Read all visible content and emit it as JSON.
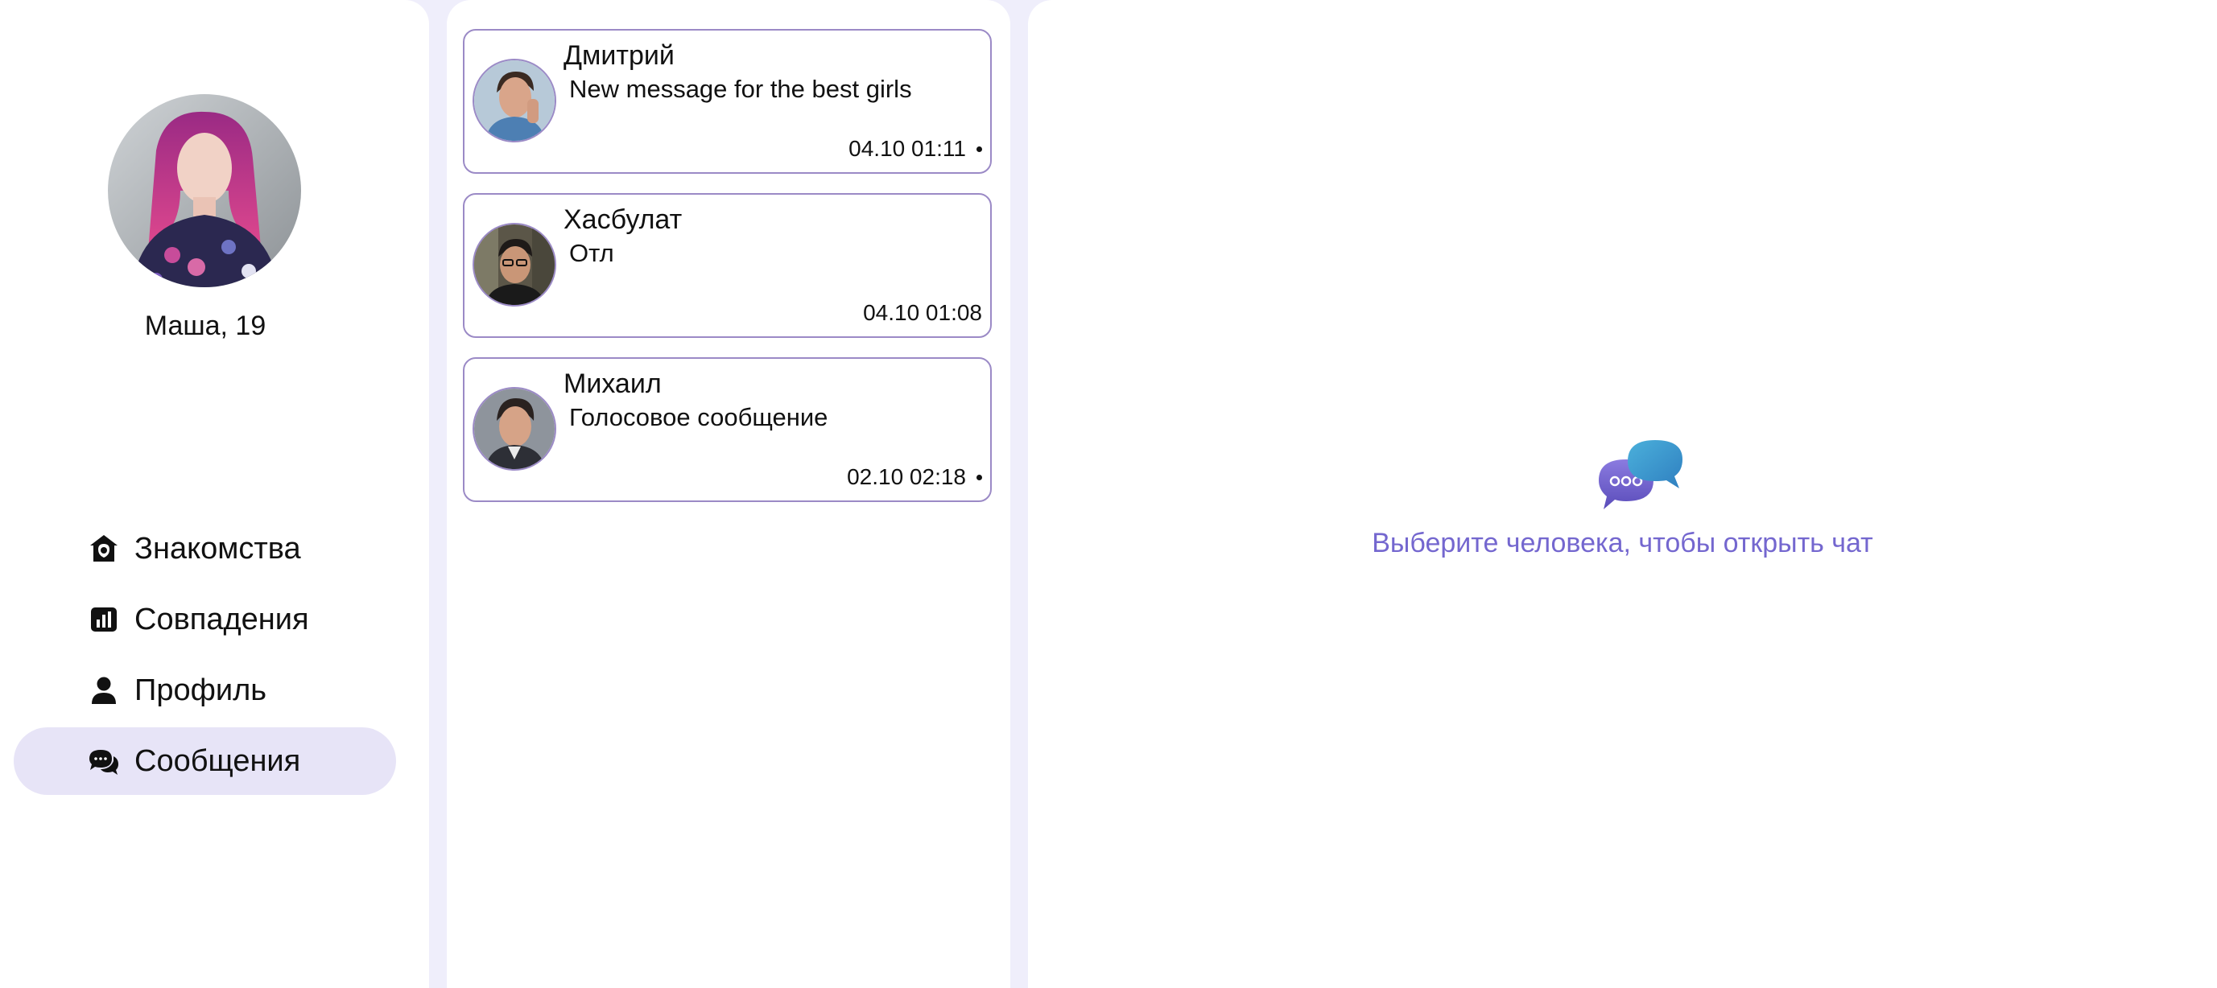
{
  "colors": {
    "background": "#efeefb",
    "panel": "#ffffff",
    "card_border": "#9b8ac6",
    "active_nav": "#e7e4f7",
    "accent_text": "#7467cf"
  },
  "profile": {
    "name_age": "Маша, 19"
  },
  "nav": {
    "items": [
      {
        "label": "Знакомства",
        "icon": "house-heart-icon",
        "active": false
      },
      {
        "label": "Совпадения",
        "icon": "bar-chart-icon",
        "active": false
      },
      {
        "label": "Профиль",
        "icon": "user-icon",
        "active": false
      },
      {
        "label": "Сообщения",
        "icon": "chat-bubbles-icon",
        "active": true
      }
    ]
  },
  "chats": [
    {
      "name": "Дмитрий",
      "message": "New message for the best girls",
      "time": "04.10 01:11",
      "unread": true
    },
    {
      "name": "Хасбулат",
      "message": "Отл",
      "time": "04.10 01:08",
      "unread": false
    },
    {
      "name": "Михаил",
      "message": "Голосовое сообщение",
      "time": "02.10 02:18",
      "unread": true
    }
  ],
  "chat_panel": {
    "empty_icon": "chat-bubbles-icon",
    "empty_text": "Выберите человека, чтобы открыть чат"
  }
}
